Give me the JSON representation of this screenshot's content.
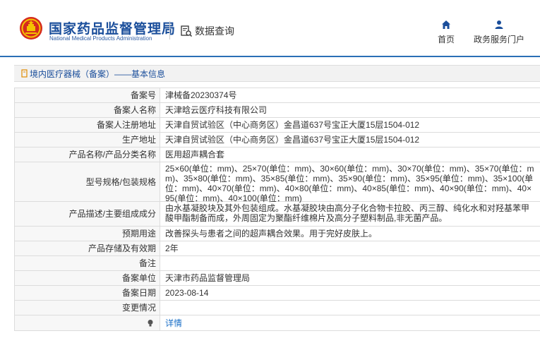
{
  "header": {
    "title_cn": "国家药品监督管理局",
    "title_en": "National Medical Products Administration",
    "query_label": "数据查询",
    "nav": [
      {
        "label": "首页",
        "icon": "home-icon"
      },
      {
        "label": "政务服务门户",
        "icon": "user-icon"
      }
    ]
  },
  "breadcrumb": "境内医疗器械（备案）——基本信息",
  "colors": {
    "brand_blue": "#1a4e9b",
    "link_blue": "#1a6fc7",
    "line_blue": "#2b6fb6",
    "emblem_red": "#d52b1e",
    "emblem_gold": "#f5c400"
  },
  "fields": [
    {
      "label": "备案号",
      "value": "津械备20230374号"
    },
    {
      "label": "备案人名称",
      "value": "天津晗云医疗科技有限公司"
    },
    {
      "label": "备案人注册地址",
      "value": "天津自贸试验区（中心商务区）金昌道637号宝正大厦15层1504-012"
    },
    {
      "label": "生产地址",
      "value": "天津自贸试验区（中心商务区）金昌道637号宝正大厦15层1504-012"
    },
    {
      "label": "产品名称/产品分类名称",
      "value": "医用超声耦合套"
    },
    {
      "label": "型号规格/包装规格",
      "value": "25×60(单位：mm)、25×70(单位：mm)、30×60(单位：mm)、30×70(单位：mm)、35×70(单位：mm)、35×80(单位：mm)、35×85(单位：mm)、35×90(单位：mm)、35×95(单位：mm)、35×100(单位：mm)、40×70(单位：mm)、40×80(单位：mm)、40×85(单位：mm)、40×90(单位：mm)、40×95(单位：mm)、40×100(单位：mm)"
    },
    {
      "label": "产品描述/主要组成成分",
      "value": "由水基凝胶块及其外包装组成。水基凝胶块由高分子化合物卡拉胶、丙三醇、纯化水和对羟基苯甲酸甲酯制备而成，外周固定为聚酯纤维棉片及高分子塑料制品,非无菌产品。"
    },
    {
      "label": "预期用途",
      "value": "改善探头与患者之间的超声耦合效果。用于完好皮肤上。"
    },
    {
      "label": "产品存储及有效期",
      "value": "2年"
    },
    {
      "label": "备注",
      "value": ""
    },
    {
      "label": "备案单位",
      "value": "天津市药品监督管理局"
    },
    {
      "label": "备案日期",
      "value": "2023-08-14"
    },
    {
      "label": "变更情况",
      "value": ""
    },
    {
      "label": "",
      "value": "详情",
      "icon": "lightbulb-icon"
    }
  ]
}
